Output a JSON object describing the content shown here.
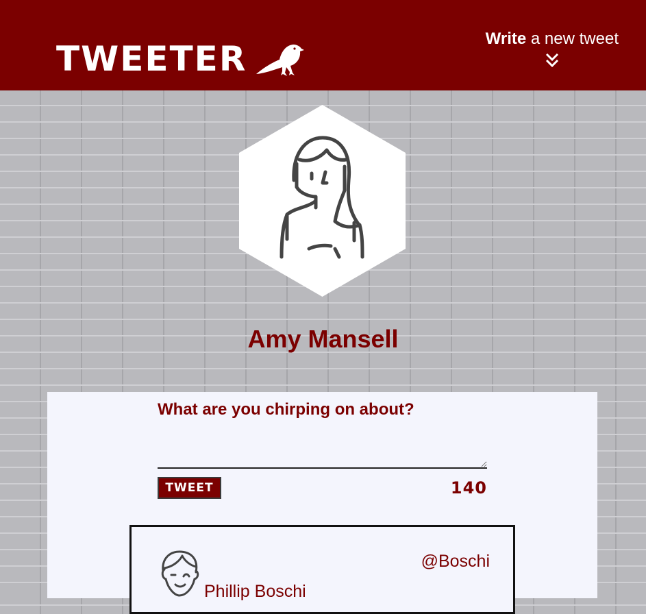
{
  "nav": {
    "brand": "TWEETER",
    "brand_icon": "bird-icon",
    "compose_strong": "Write",
    "compose_rest": " a new tweet",
    "compose_icon": "double-chevron-down-icon"
  },
  "profile": {
    "name": "Amy Mansell",
    "avatar_icon": "woman-avatar-icon"
  },
  "new_tweet": {
    "label": "What are you chirping on about?",
    "text": "",
    "button": "TWEET",
    "counter": "140"
  },
  "tweets": [
    {
      "name": "Phillip Boschi",
      "handle": "@Boschi",
      "avatar_icon": "man-avatar-icon"
    }
  ],
  "colors": {
    "brand": "#7b0000",
    "panel": "#f4f5fd",
    "wall": "#b9b9bd"
  }
}
